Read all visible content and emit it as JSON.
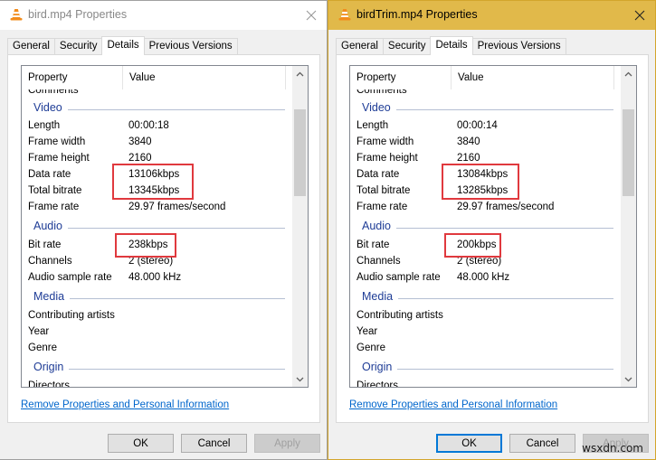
{
  "windows": [
    {
      "id": "left",
      "title": "bird.mp4 Properties",
      "active": false,
      "tabs": [
        "General",
        "Security",
        "Details",
        "Previous Versions"
      ],
      "active_tab": "Details",
      "columns": {
        "property": "Property",
        "value": "Value"
      },
      "partial_top_row": "Comments",
      "sections": [
        {
          "name": "Video",
          "rows": [
            {
              "k": "Length",
              "v": "00:00:18"
            },
            {
              "k": "Frame width",
              "v": "3840"
            },
            {
              "k": "Frame height",
              "v": "2160"
            },
            {
              "k": "Data rate",
              "v": "13106kbps"
            },
            {
              "k": "Total bitrate",
              "v": "13345kbps"
            },
            {
              "k": "Frame rate",
              "v": "29.97 frames/second"
            }
          ]
        },
        {
          "name": "Audio",
          "rows": [
            {
              "k": "Bit rate",
              "v": "238kbps"
            },
            {
              "k": "Channels",
              "v": "2 (stereo)"
            },
            {
              "k": "Audio sample rate",
              "v": "48.000 kHz"
            }
          ]
        },
        {
          "name": "Media",
          "rows": [
            {
              "k": "Contributing artists",
              "v": ""
            },
            {
              "k": "Year",
              "v": ""
            },
            {
              "k": "Genre",
              "v": ""
            }
          ]
        },
        {
          "name": "Origin",
          "rows": []
        }
      ],
      "partial_bottom_row": "Directors",
      "link": "Remove Properties and Personal Information",
      "buttons": {
        "ok": "OK",
        "cancel": "Cancel",
        "apply": "Apply"
      }
    },
    {
      "id": "right",
      "title": "birdTrim.mp4 Properties",
      "active": true,
      "tabs": [
        "General",
        "Security",
        "Details",
        "Previous Versions"
      ],
      "active_tab": "Details",
      "columns": {
        "property": "Property",
        "value": "Value"
      },
      "partial_top_row": "Comments",
      "sections": [
        {
          "name": "Video",
          "rows": [
            {
              "k": "Length",
              "v": "00:00:14"
            },
            {
              "k": "Frame width",
              "v": "3840"
            },
            {
              "k": "Frame height",
              "v": "2160"
            },
            {
              "k": "Data rate",
              "v": "13084kbps"
            },
            {
              "k": "Total bitrate",
              "v": "13285kbps"
            },
            {
              "k": "Frame rate",
              "v": "29.97 frames/second"
            }
          ]
        },
        {
          "name": "Audio",
          "rows": [
            {
              "k": "Bit rate",
              "v": "200kbps"
            },
            {
              "k": "Channels",
              "v": "2 (stereo)"
            },
            {
              "k": "Audio sample rate",
              "v": "48.000 kHz"
            }
          ]
        },
        {
          "name": "Media",
          "rows": [
            {
              "k": "Contributing artists",
              "v": ""
            },
            {
              "k": "Year",
              "v": ""
            },
            {
              "k": "Genre",
              "v": ""
            }
          ]
        },
        {
          "name": "Origin",
          "rows": []
        }
      ],
      "partial_bottom_row": "Directors",
      "link": "Remove Properties and Personal Information",
      "buttons": {
        "ok": "OK",
        "cancel": "Cancel",
        "apply": "Apply"
      }
    }
  ],
  "icons": {
    "app": "vlc-cone-icon",
    "close": "close-icon",
    "scroll_up": "chevron-up-icon",
    "scroll_down": "chevron-down-icon"
  },
  "colors": {
    "active_titlebar": "#e1b94a",
    "highlight_box": "#e0393e",
    "section_header": "#1e3c96",
    "link": "#0066cc",
    "default_button_border": "#0078d7"
  },
  "watermark": "wsxdn.com"
}
